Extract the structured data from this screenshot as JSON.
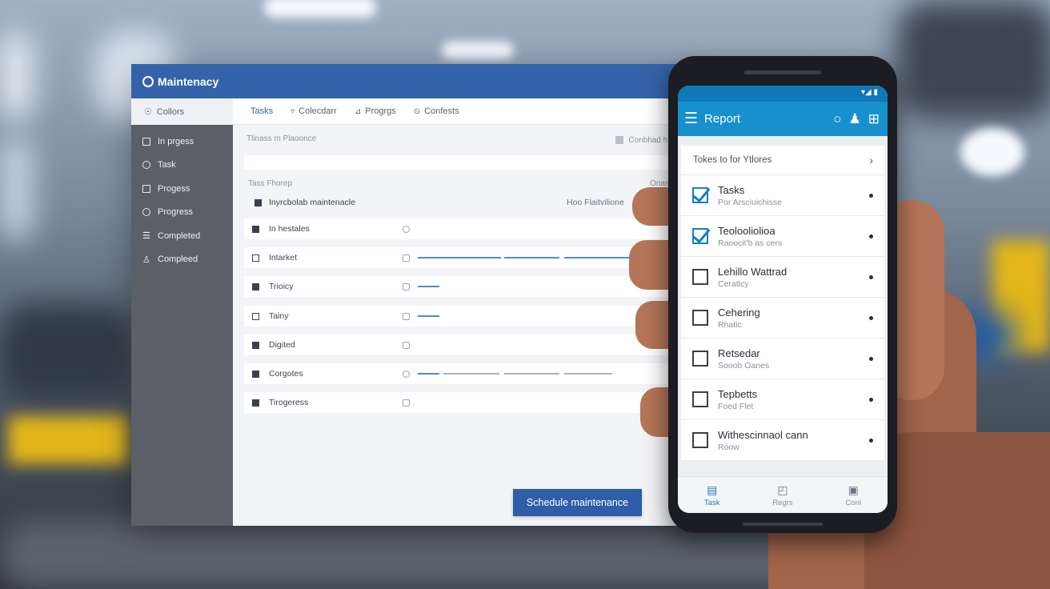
{
  "desktop_app": {
    "title": "Maintenacy",
    "sidebar": {
      "header": "Collors",
      "items": [
        {
          "label": "In prgess",
          "icon": "square-icon"
        },
        {
          "label": "Task",
          "icon": "circle-icon"
        },
        {
          "label": "Progess",
          "icon": "square-icon"
        },
        {
          "label": "Progress",
          "icon": "pin-icon"
        },
        {
          "label": "Completed",
          "icon": "list-icon"
        },
        {
          "label": "Compleed",
          "icon": "person-icon"
        }
      ]
    },
    "tabs": [
      {
        "label": "Tasks",
        "active": true
      },
      {
        "label": "Colecdarr",
        "active": false
      },
      {
        "label": "Progrgs",
        "active": false
      },
      {
        "label": "Confests",
        "active": false
      }
    ],
    "subheader": {
      "left": "Tlinass m Plaoonce",
      "right": "Conbhad hin"
    },
    "table_header": {
      "left": "Tass Fhorep",
      "right": "Onas"
    },
    "header_row": {
      "label": "Inyrcbolab maintenacle",
      "right": "Hoo Flaitvilione"
    },
    "rows": [
      {
        "label": "In hestales"
      },
      {
        "label": "Intarket"
      },
      {
        "label": "Trioicy"
      },
      {
        "label": "Tainy"
      },
      {
        "label": "Digited"
      },
      {
        "label": "Corgotes"
      },
      {
        "label": "Tirogeress"
      }
    ],
    "schedule_button": "Schedule maintenance"
  },
  "mobile_app": {
    "title": "Report",
    "list_header": "Tokes to for Ytlores",
    "items": [
      {
        "title": "Tasks",
        "subtitle": "Por Arsciuichisse",
        "checked": true
      },
      {
        "title": "Teolooliolioa",
        "subtitle": "Raoocit'b as cers",
        "checked": true
      },
      {
        "title": "Lehillo Wattrad",
        "subtitle": "Ceratlcy",
        "checked": false
      },
      {
        "title": "Cehering",
        "subtitle": "Rhatic",
        "checked": false
      },
      {
        "title": "Retsedar",
        "subtitle": "Sooob Oanes",
        "checked": false
      },
      {
        "title": "Tepbetts",
        "subtitle": "Foed Flet",
        "checked": false
      },
      {
        "title": "Withescinnaol cann",
        "subtitle": "Roow",
        "checked": false
      }
    ],
    "bottom_nav": [
      {
        "label": "Task",
        "active": true
      },
      {
        "label": "Regrs",
        "active": false
      },
      {
        "label": "Conl",
        "active": false
      }
    ]
  },
  "colors": {
    "desktop_accent": "#3563a9",
    "mobile_accent": "#1890ce"
  }
}
